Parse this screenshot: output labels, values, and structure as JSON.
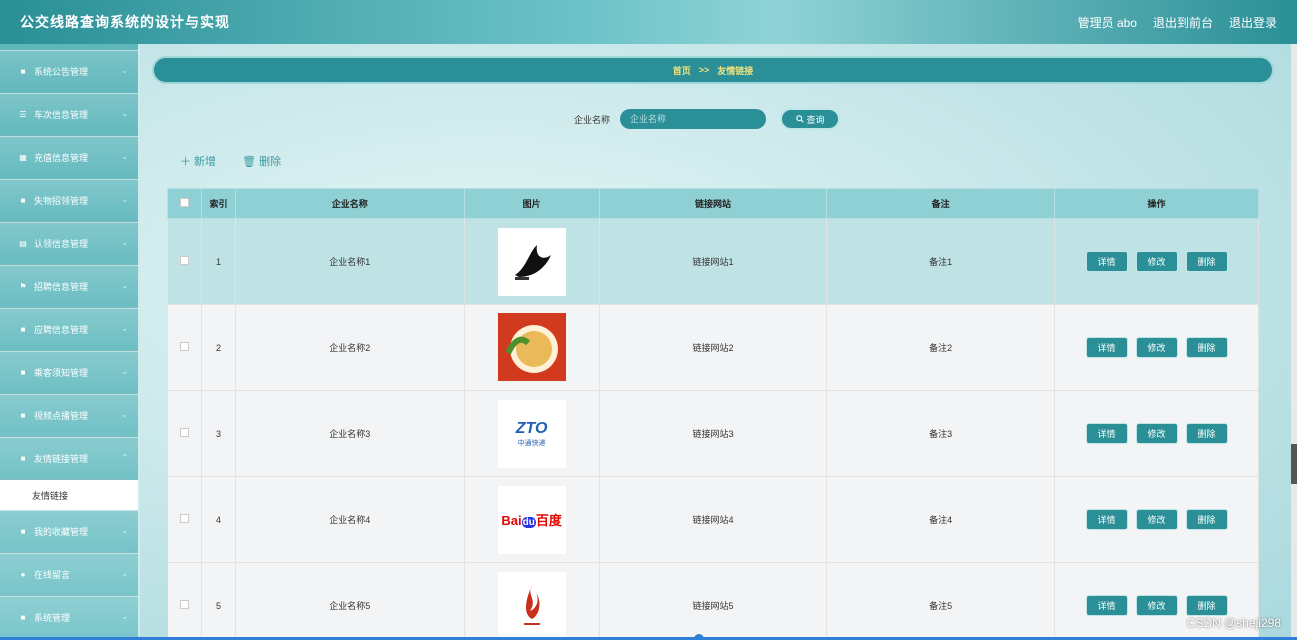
{
  "header": {
    "title": "公交线路查询系统的设计与实现",
    "admin": "管理员 abo",
    "to_front": "退出到前台",
    "logout": "退出登录"
  },
  "sidebar": {
    "items": [
      {
        "label": "系统公告管理",
        "icon": "grid-icon"
      },
      {
        "label": "车次信息管理",
        "icon": "list-icon"
      },
      {
        "label": "充值信息管理",
        "icon": "grid9-icon"
      },
      {
        "label": "失物招领管理",
        "icon": "grid-icon"
      },
      {
        "label": "认领信息管理",
        "icon": "clipboard-icon"
      },
      {
        "label": "招聘信息管理",
        "icon": "flag-icon"
      },
      {
        "label": "应聘信息管理",
        "icon": "grid-icon"
      },
      {
        "label": "乘客须知管理",
        "icon": "grid-icon"
      },
      {
        "label": "视频点播管理",
        "icon": "grid-icon"
      },
      {
        "label": "友情链接管理",
        "icon": "grid-icon"
      }
    ],
    "sub_item": "友情链接",
    "items_after": [
      {
        "label": "我的收藏管理",
        "icon": "grid-icon"
      },
      {
        "label": "在线留言",
        "icon": "pin-icon"
      },
      {
        "label": "系统管理",
        "icon": "grid-icon"
      }
    ]
  },
  "breadcrumb": {
    "home": "首页",
    "sep": ">>",
    "current": "友情链接"
  },
  "search": {
    "label": "企业名称",
    "placeholder": "企业名称",
    "button": "查询"
  },
  "actions": {
    "add": "＋ 新增",
    "delete": "🗑 删除"
  },
  "table": {
    "headers": [
      "索引",
      "企业名称",
      "图片",
      "链接网站",
      "备注",
      "操作"
    ],
    "rows": [
      {
        "index": "1",
        "name": "企业名称1",
        "site": "链接网站1",
        "note": "备注1"
      },
      {
        "index": "2",
        "name": "企业名称2",
        "site": "链接网站2",
        "note": "备注2"
      },
      {
        "index": "3",
        "name": "企业名称3",
        "site": "链接网站3",
        "note": "备注3"
      },
      {
        "index": "4",
        "name": "企业名称4",
        "site": "链接网站4",
        "note": "备注4"
      },
      {
        "index": "5",
        "name": "企业名称5",
        "site": "链接网站5",
        "note": "备注5"
      }
    ],
    "op_labels": {
      "detail": "详情",
      "edit": "修改",
      "del": "删除"
    }
  },
  "logos": {
    "zto": "ZTO",
    "zto_sub": "中通快递",
    "baidu_bai": "Bai",
    "baidu_du": "du",
    "baidu_cn": "百度"
  },
  "watermark": "CSDN @sheji298"
}
